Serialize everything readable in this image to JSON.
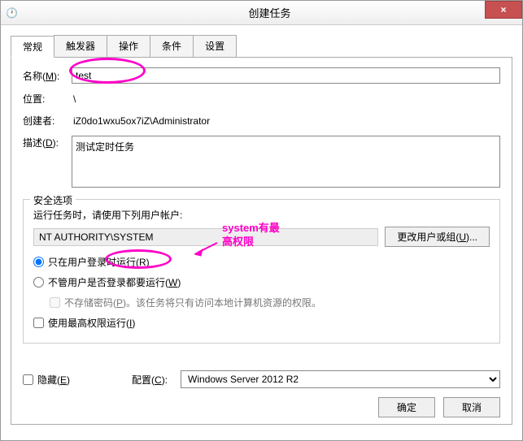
{
  "window": {
    "title": "创建任务",
    "close": "×"
  },
  "tabs": {
    "general": "常规",
    "triggers": "触发器",
    "actions": "操作",
    "conditions": "条件",
    "settings": "设置"
  },
  "form": {
    "name_label": "名称(",
    "name_key": "M",
    "name_label_end": "):",
    "name_value": "test",
    "location_label": "位置:",
    "location_value": "\\",
    "author_label": "创建者:",
    "author_value": "iZ0do1wxu5ox7iZ\\Administrator",
    "desc_label": "描述(",
    "desc_key": "D",
    "desc_label_end": "):",
    "desc_value": "测试定时任务"
  },
  "security": {
    "legend": "安全选项",
    "run_as_label": "运行任务时，请使用下列用户帐户:",
    "account": "NT AUTHORITY\\SYSTEM",
    "change_user_btn": "更改用户或组(",
    "change_user_key": "U",
    "change_user_end": ")...",
    "radio_logged_on": "只在用户登录时运行(",
    "radio_logged_on_key": "R",
    "radio_logged_on_end": ")",
    "radio_any": "不管用户是否登录都要运行(",
    "radio_any_key": "W",
    "radio_any_end": ")",
    "no_store_pwd": "不存储密码(",
    "no_store_pwd_key": "P",
    "no_store_pwd_end": ")。该任务将只有访问本地计算机资源的权限。",
    "highest_priv": "使用最高权限运行(",
    "highest_priv_key": "I",
    "highest_priv_end": ")"
  },
  "bottom": {
    "hidden_label": "隐藏(",
    "hidden_key": "E",
    "hidden_end": ")",
    "config_label": "配置(",
    "config_key": "C",
    "config_end": "):",
    "config_value": "Windows Server 2012 R2"
  },
  "buttons": {
    "ok": "确定",
    "cancel": "取消"
  },
  "annotations": {
    "system_note": "system有最\n高权限"
  }
}
